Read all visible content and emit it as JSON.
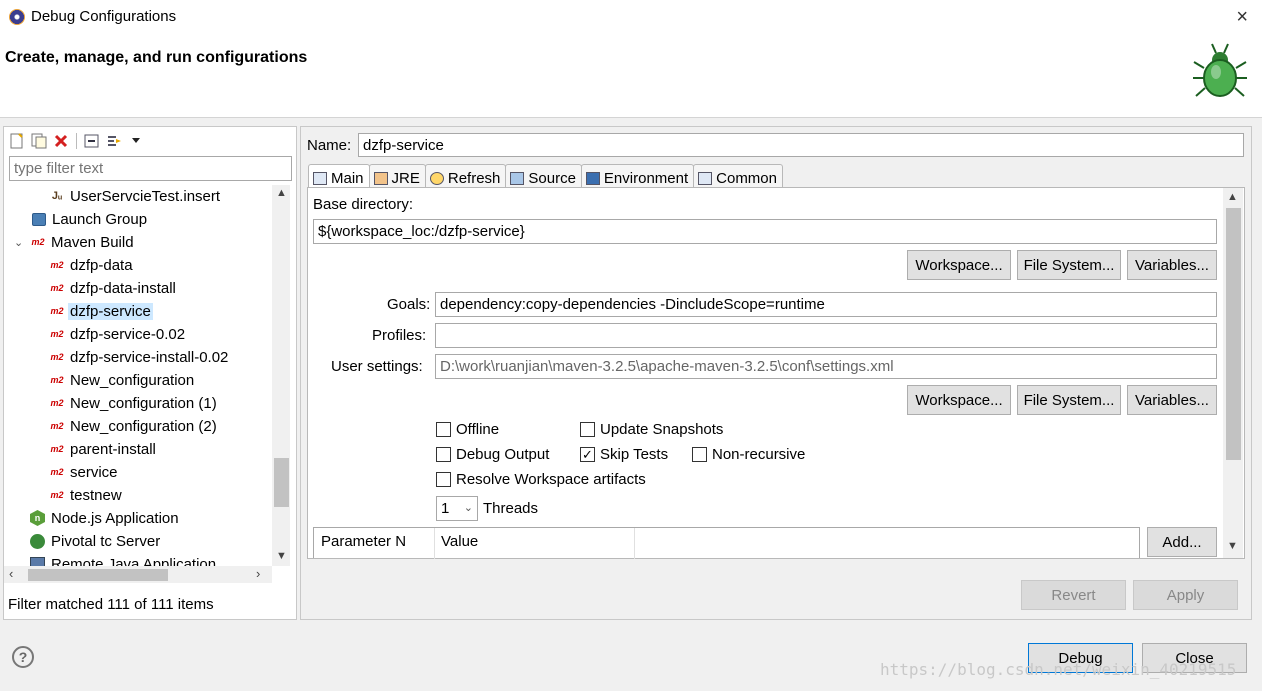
{
  "window": {
    "title": "Debug Configurations",
    "close_icon": "×"
  },
  "banner": {
    "heading": "Create, manage, and run configurations"
  },
  "left": {
    "toolbar_icons": [
      "new-config-icon",
      "duplicate-icon",
      "delete-icon",
      "collapse-all-icon",
      "filter-icon",
      "dropdown-icon"
    ],
    "filter_placeholder": "type filter text",
    "tree": [
      {
        "label": "UserServcieTest.insert",
        "icon": "junit-icon",
        "icon_glyph": "Jᵤ",
        "level": 2
      },
      {
        "label": "Launch Group",
        "icon": "launch-group-icon",
        "level": 1
      },
      {
        "label": "Maven Build",
        "icon": "maven-icon",
        "icon_glyph": "m2",
        "level": 1,
        "expanded": true
      },
      {
        "label": "dzfp-data",
        "icon": "maven-icon",
        "icon_glyph": "m2",
        "level": 2
      },
      {
        "label": "dzfp-data-install",
        "icon": "maven-icon",
        "icon_glyph": "m2",
        "level": 2
      },
      {
        "label": "dzfp-service",
        "icon": "maven-icon",
        "icon_glyph": "m2",
        "level": 2,
        "selected": true
      },
      {
        "label": "dzfp-service-0.02",
        "icon": "maven-icon",
        "icon_glyph": "m2",
        "level": 2
      },
      {
        "label": "dzfp-service-install-0.02",
        "icon": "maven-icon",
        "icon_glyph": "m2",
        "level": 2
      },
      {
        "label": "New_configuration",
        "icon": "maven-icon",
        "icon_glyph": "m2",
        "level": 2
      },
      {
        "label": "New_configuration (1)",
        "icon": "maven-icon",
        "icon_glyph": "m2",
        "level": 2
      },
      {
        "label": "New_configuration (2)",
        "icon": "maven-icon",
        "icon_glyph": "m2",
        "level": 2
      },
      {
        "label": "parent-install",
        "icon": "maven-icon",
        "icon_glyph": "m2",
        "level": 2
      },
      {
        "label": "service",
        "icon": "maven-icon",
        "icon_glyph": "m2",
        "level": 2
      },
      {
        "label": "testnew",
        "icon": "maven-icon",
        "icon_glyph": "m2",
        "level": 2
      },
      {
        "label": "Node.js Application",
        "icon": "nodejs-icon",
        "icon_glyph": "n",
        "level": 1
      },
      {
        "label": "Pivotal tc Server",
        "icon": "pivotal-icon",
        "level": 1
      },
      {
        "label": "Remote Java Application",
        "icon": "remote-java-icon",
        "level": 1
      }
    ],
    "status": "Filter matched 111 of 111 items"
  },
  "right": {
    "name_label": "Name:",
    "name_value": "dzfp-service",
    "tabs": [
      {
        "label": "Main",
        "icon": "main-tab-icon",
        "active": true
      },
      {
        "label": "JRE",
        "icon": "jre-icon"
      },
      {
        "label": "Refresh",
        "icon": "refresh-icon"
      },
      {
        "label": "Source",
        "icon": "source-icon"
      },
      {
        "label": "Environment",
        "icon": "environment-icon"
      },
      {
        "label": "Common",
        "icon": "common-icon"
      }
    ],
    "base_dir_label": "Base directory:",
    "base_dir_value": "${workspace_loc:/dzfp-service}",
    "workspace_btn": "Workspace...",
    "filesystem_btn": "File System...",
    "variables_btn": "Variables...",
    "goals_label": "Goals:",
    "goals_value": "dependency:copy-dependencies -DincludeScope=runtime",
    "profiles_label": "Profiles:",
    "profiles_value": "",
    "user_settings_label": "User settings:",
    "user_settings_value": "D:\\work\\ruanjian\\maven-3.2.5\\apache-maven-3.2.5\\conf\\settings.xml",
    "checkboxes": {
      "offline": {
        "label": "Offline",
        "checked": false
      },
      "update_snapshots": {
        "label": "Update Snapshots",
        "checked": false
      },
      "debug_output": {
        "label": "Debug Output",
        "checked": false
      },
      "skip_tests": {
        "label": "Skip Tests",
        "checked": true
      },
      "non_recursive": {
        "label": "Non-recursive",
        "checked": false
      },
      "resolve_workspace": {
        "label": "Resolve Workspace artifacts",
        "checked": false
      }
    },
    "threads_value": "1",
    "threads_label": "Threads",
    "param_columns": [
      "Parameter N",
      "Value"
    ],
    "add_btn": "Add...",
    "revert_btn": "Revert",
    "apply_btn": "Apply"
  },
  "footer": {
    "help_glyph": "?",
    "debug_btn": "Debug",
    "close_btn": "Close",
    "watermark": "https://blog.csdn.net/weixin_40219515"
  }
}
